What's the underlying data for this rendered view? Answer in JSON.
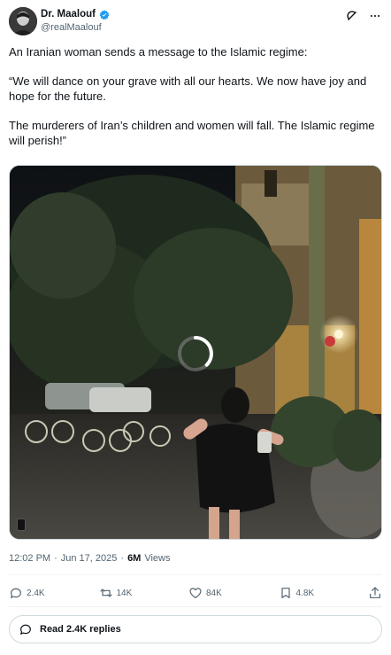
{
  "author": {
    "display_name": "Dr. Maalouf",
    "handle": "@realMaalouf",
    "verified": true,
    "verified_color": "#1d9bf0"
  },
  "header_actions": [
    {
      "icon": "grok-icon"
    },
    {
      "icon": "more-icon"
    }
  ],
  "tweet": {
    "paragraphs": [
      "An Iranian woman sends a message to the Islamic regime:",
      "“We will dance on your grave with all our hearts. We now have joy and hope for the future.",
      "The murderers of Iran’s children and women will fall. The Islamic regime will perish!”"
    ]
  },
  "media": {
    "type": "video",
    "state": "loading",
    "spinner_icon": "loading-spinner-icon"
  },
  "meta": {
    "time": "12:02 PM",
    "separator": "·",
    "date": "Jun 17, 2025",
    "separator2": "·",
    "views_count": "6M",
    "views_label": "Views"
  },
  "actions": {
    "reply": {
      "icon": "reply-icon",
      "count": "2.4K"
    },
    "repost": {
      "icon": "repost-icon",
      "count": "14K"
    },
    "like": {
      "icon": "like-icon",
      "count": "84K"
    },
    "bookmark": {
      "icon": "bookmark-icon",
      "count": "4.8K"
    },
    "share": {
      "icon": "share-icon"
    }
  },
  "read_replies": {
    "label": "Read 2.4K replies",
    "icon": "chat-bubble-icon"
  },
  "colors": {
    "text_primary": "#0f1419",
    "text_secondary": "#536471",
    "border": "#cfd9de",
    "accent": "#1d9bf0"
  }
}
